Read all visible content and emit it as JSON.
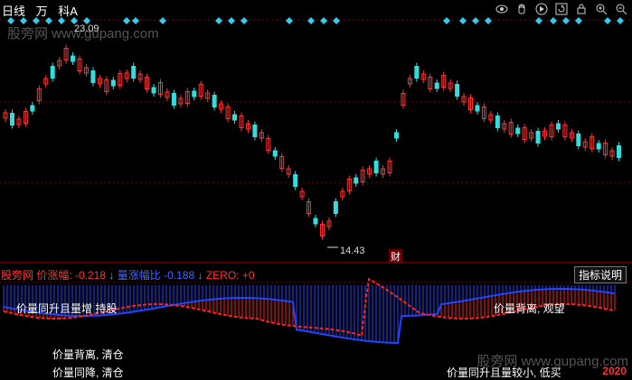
{
  "header": {
    "period": "日线",
    "name": "万",
    "code_suffix": "科A"
  },
  "toolbar_icons": [
    "eye-icon",
    "hand-icon",
    "play-icon",
    "refresh-icon",
    "lock-icon",
    "zoom-in-icon",
    "zoom-out-icon"
  ],
  "watermark": "股旁网 www.gupang.com",
  "main_chart": {
    "high_label": "23.09",
    "low_label": "14.43",
    "cai_label": "财",
    "up_color": "#ff3333",
    "down_color": "#33dddd"
  },
  "indicator_bar": {
    "name": "股旁网",
    "price_label": "价涨幅:",
    "price_value": "-0.218",
    "vol_label": "量涨幅比",
    "vol_value": "-0.188",
    "zero_label": "ZERO:",
    "zero_value": "+0",
    "help_button": "指标说明"
  },
  "annotations": {
    "top_left": "价量同升且量增 持股",
    "top_right": "价量背离, 观望",
    "bottom_left_1": "价量背离, 清仓",
    "bottom_left_2": "价量同降, 清仓",
    "bottom_right": "价量同升且量较小, 低买",
    "bottom_num": "2020"
  },
  "colors": {
    "price_line": "#ff2222",
    "volume_line": "#2244ff",
    "grid": "#7a0000"
  }
}
